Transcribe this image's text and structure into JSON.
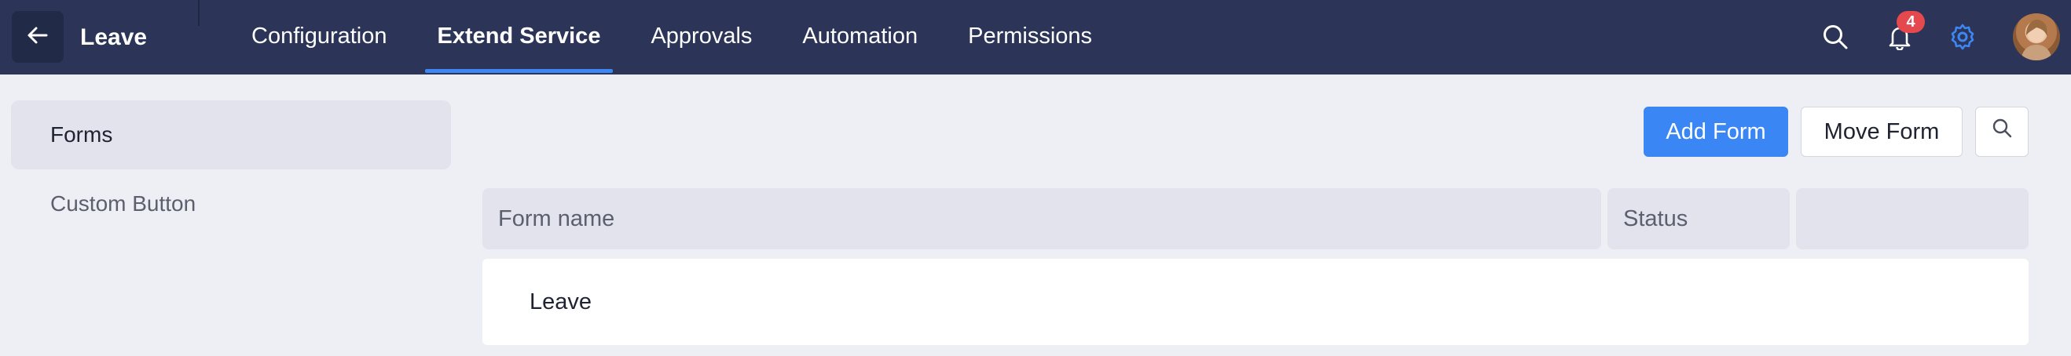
{
  "header": {
    "title": "Leave",
    "nav_tabs": [
      {
        "label": "Configuration"
      },
      {
        "label": "Extend Service",
        "active": true
      },
      {
        "label": "Approvals"
      },
      {
        "label": "Automation"
      },
      {
        "label": "Permissions"
      }
    ],
    "notification_count": "4",
    "icons": [
      "back-arrow-icon",
      "search-icon",
      "bell-icon",
      "gear-icon",
      "avatar"
    ],
    "colors": {
      "header_bg": "#2c3558",
      "accent": "#3d87f5",
      "badge": "#e5484d"
    }
  },
  "sidebar": {
    "items": [
      {
        "label": "Forms",
        "active": true
      },
      {
        "label": "Custom Button"
      }
    ]
  },
  "toolbar": {
    "add_form_label": "Add Form",
    "move_form_label": "Move Form"
  },
  "table": {
    "columns": [
      "Form name",
      "Status",
      ""
    ],
    "rows": [
      {
        "name": "Leave",
        "status": ""
      }
    ]
  }
}
